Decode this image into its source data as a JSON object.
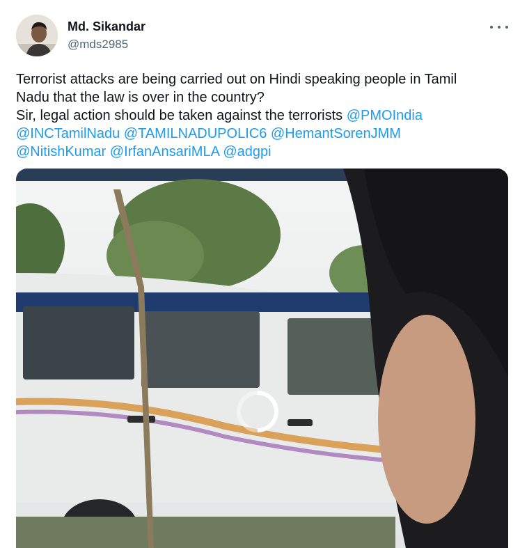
{
  "author": {
    "name": "Md. Sikandar",
    "handle": "@mds2985",
    "avatar_icon": "user-avatar"
  },
  "more_icon": "more-horizontal-icon",
  "tweet": {
    "lines": [
      {
        "text": "Terrorist attacks are being carried out on Hindi speaking people in Tamil"
      },
      {
        "text": "Nadu that the law is over in the country?"
      },
      {
        "text": "Sir, legal action should be taken against the terrorists ",
        "mention": "@PMOIndia"
      },
      {
        "mentions": [
          "@INCTamilNadu",
          "@TAMILNADUPOLIC6",
          "@HemantSorenJMM"
        ]
      },
      {
        "mentions": [
          "@NitishKumar",
          "@IrfanAnsariMLA",
          "@adgpi"
        ]
      }
    ]
  },
  "media": {
    "type": "video",
    "state": "loading",
    "loading_icon": "loading-spinner-icon"
  },
  "colors": {
    "mention": "#1d9bf0",
    "text": "#0f1419",
    "secondary": "#536471"
  }
}
